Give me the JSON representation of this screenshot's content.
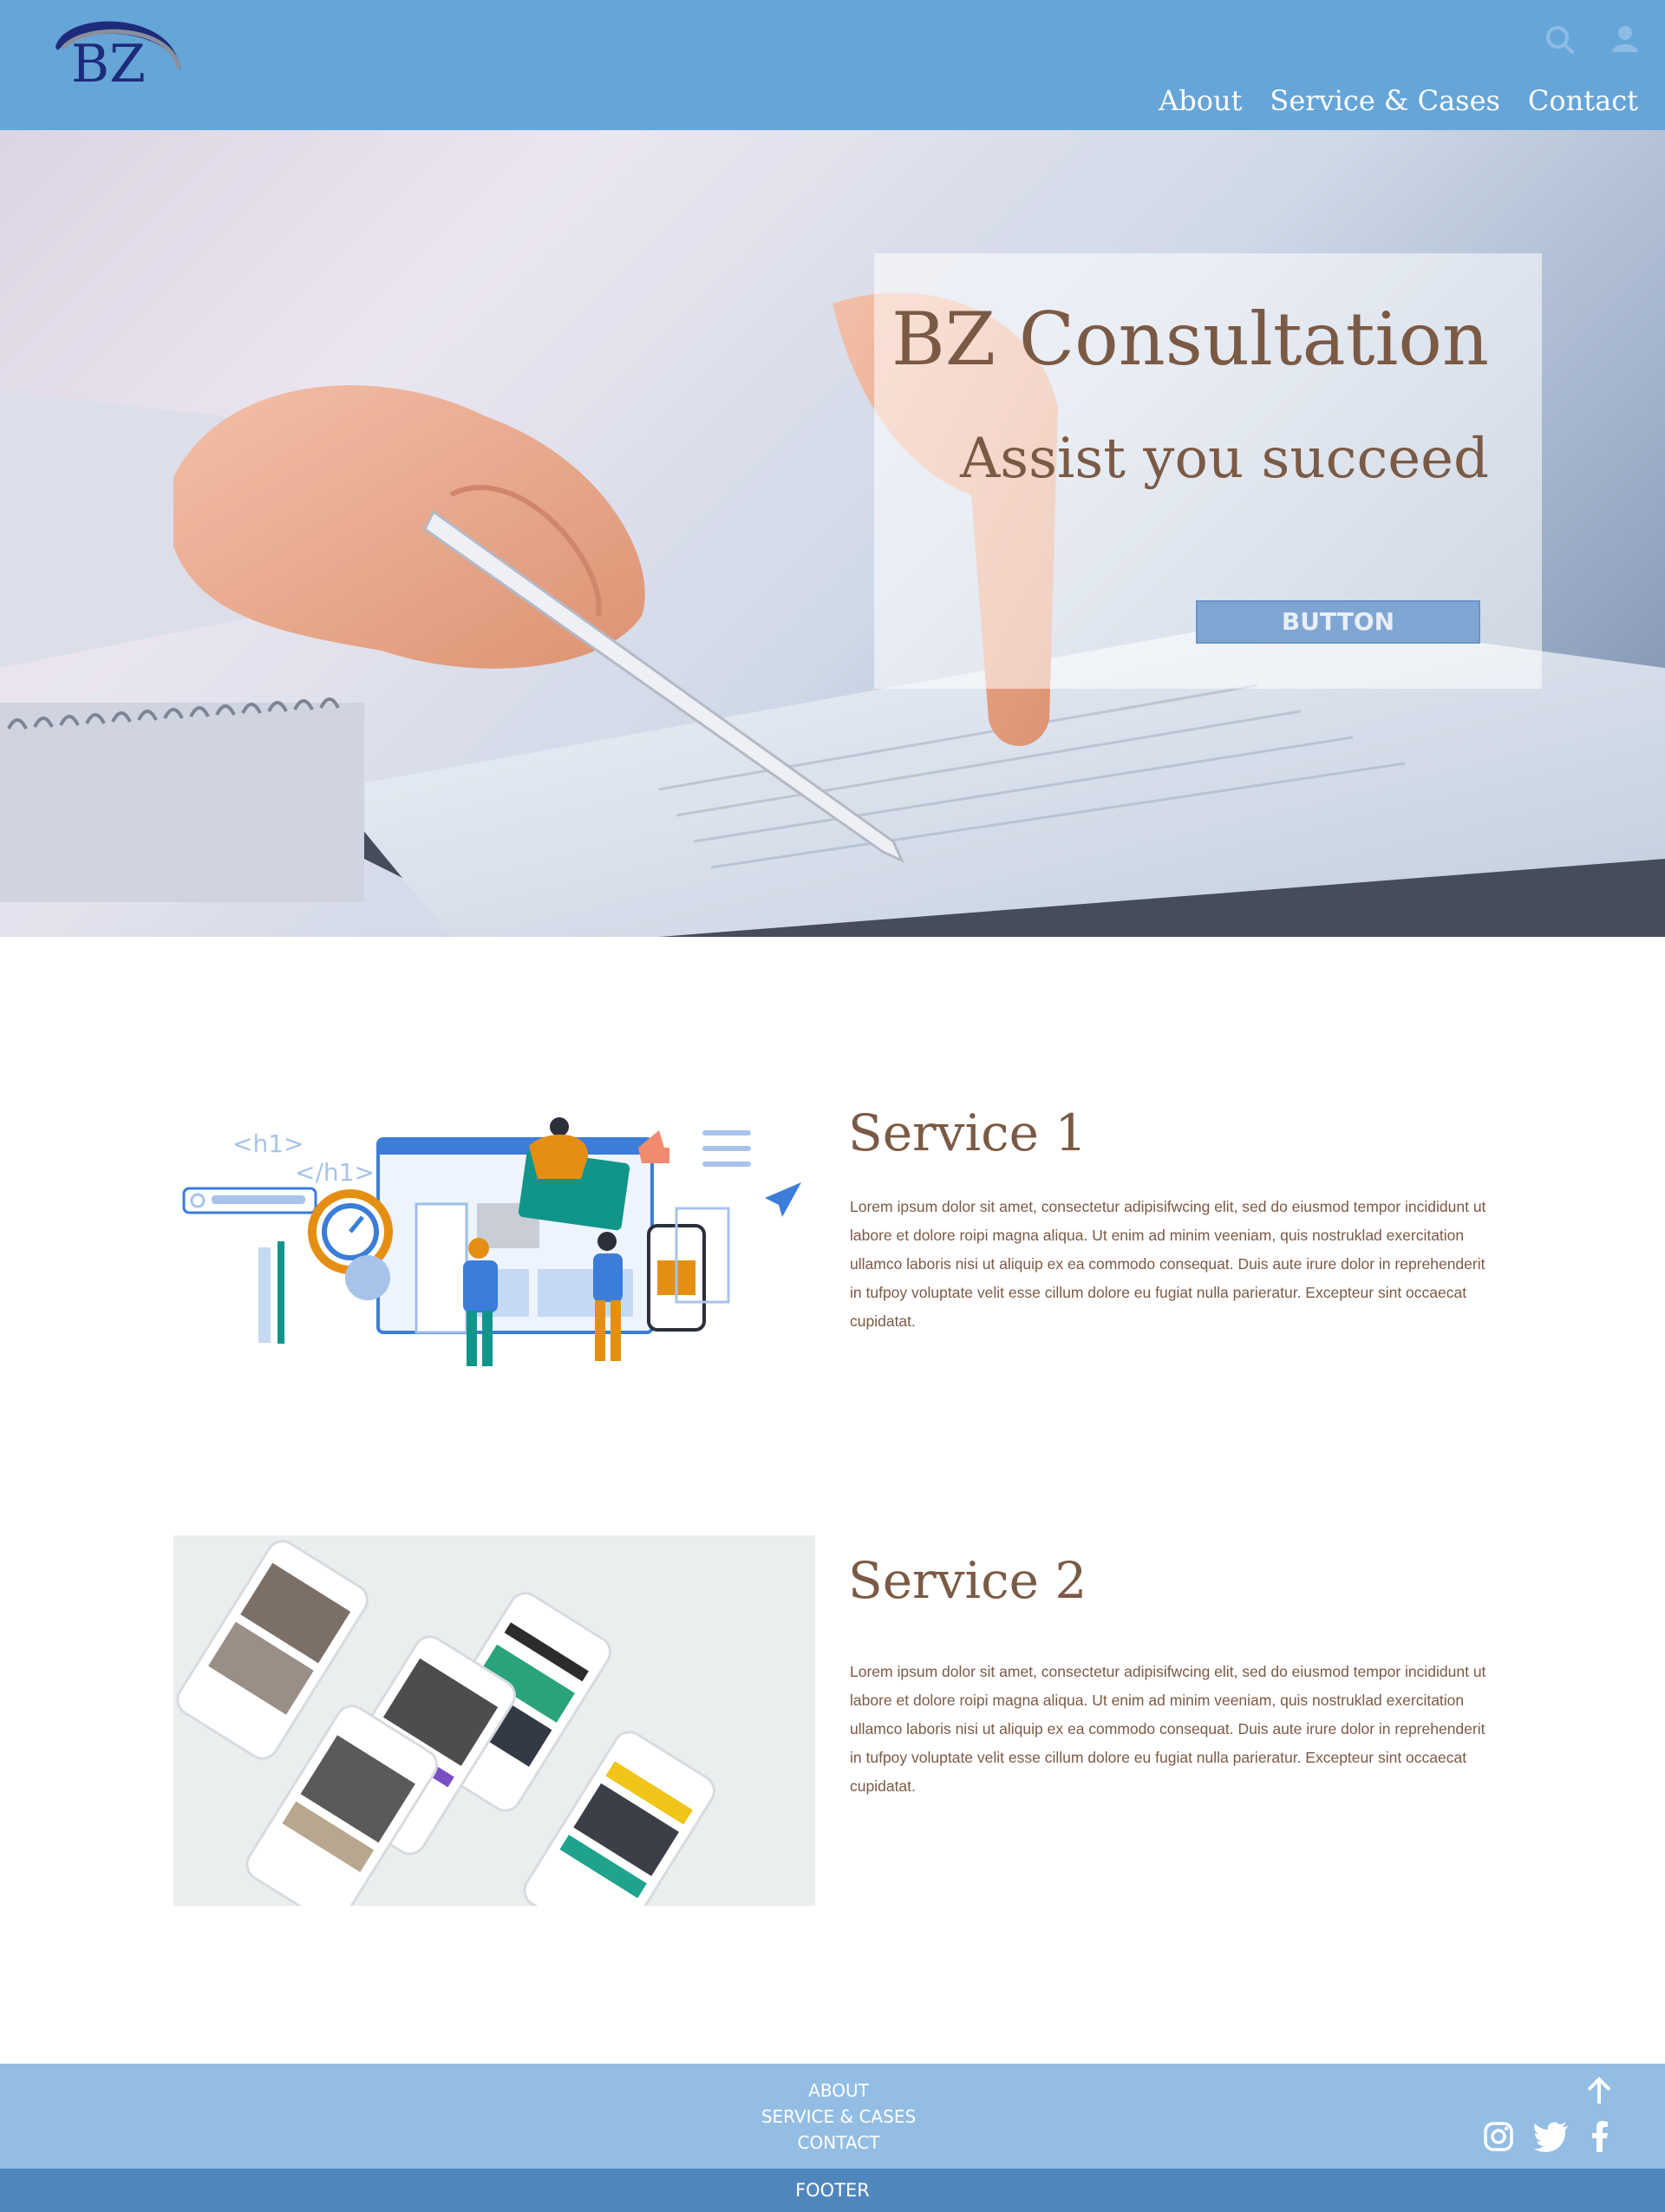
{
  "header": {
    "logo_text": "BZ",
    "icons": {
      "search": "search-icon",
      "user": "user-icon"
    },
    "nav": [
      {
        "label": "About"
      },
      {
        "label": "Service & Cases"
      },
      {
        "label": "Contact"
      }
    ],
    "background_color": "#66a5d8"
  },
  "hero": {
    "title": "BZ Consultation",
    "subtitle": "Assist you succeed",
    "button_label": "BUTTON"
  },
  "services": [
    {
      "title": "Service 1",
      "image_labels": [
        "<h1>",
        "</h1>"
      ],
      "text": "Lorem ipsum dolor sit amet, consectetur adipisifwcing elit, sed do eiusmod tempor incididunt ut labore et dolore roipi magna aliqua. Ut enim ad minim veeniam, quis nostruklad exercitation ullamco laboris nisi ut aliquip ex ea commodo consequat. Duis aute irure dolor in reprehenderit in tufpoy voluptate velit esse cillum dolore eu fugiat nulla parieratur. Excepteur sint occaecat cupidatat."
    },
    {
      "title": "Service 2",
      "text": "Lorem ipsum dolor sit amet, consectetur adipisifwcing elit, sed do eiusmod tempor incididunt ut labore et dolore roipi magna aliqua. Ut enim ad minim veeniam, quis nostruklad exercitation ullamco laboris nisi ut aliquip ex ea commodo consequat. Duis aute irure dolor in reprehenderit in tufpoy voluptate velit esse cillum dolore eu fugiat nulla parieratur. Excepteur sint occaecat cupidatat."
    }
  ],
  "footer": {
    "links": [
      {
        "label": "ABOUT"
      },
      {
        "label": "SERVICE & CASES"
      },
      {
        "label": "CONTACT"
      }
    ],
    "icons": [
      "arrow-up-icon",
      "instagram-icon",
      "twitter-icon",
      "facebook-icon"
    ],
    "bottom_label": "FOOTER"
  },
  "colors": {
    "primary": "#66a5d8",
    "footer": "#93bde3",
    "bottom_bar": "#4f86bc",
    "heading": "#7b5a45"
  }
}
